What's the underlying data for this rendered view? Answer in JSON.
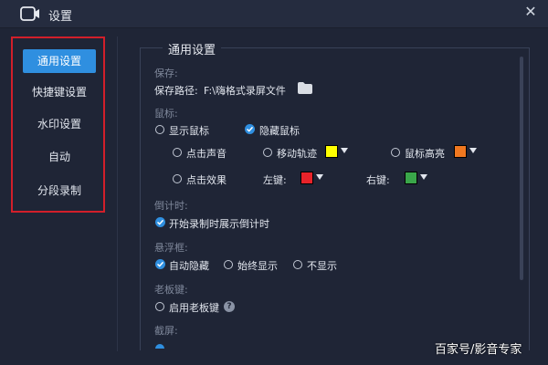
{
  "window": {
    "title": "设置",
    "close_icon": "close-icon",
    "app_icon": "video-camera-icon"
  },
  "sidebar": {
    "items": [
      {
        "label": "通用设置",
        "active": true
      },
      {
        "label": "快捷键设置",
        "active": false
      },
      {
        "label": "水印设置",
        "active": false
      },
      {
        "label": "自动",
        "active": false
      },
      {
        "label": "分段录制",
        "active": false
      }
    ]
  },
  "general": {
    "panel_title": "通用设置",
    "save": {
      "section": "保存:",
      "path_label": "保存路径:",
      "path_value": "F:\\嗨格式录屏文件",
      "folder_icon": "folder-icon"
    },
    "mouse": {
      "section": "鼠标:",
      "show_cursor": "显示鼠标",
      "hide_cursor": "隐藏鼠标",
      "click_sound": "点击声音",
      "move_track": "移动轨迹",
      "cursor_highlight": "鼠标高亮",
      "click_effect": "点击效果",
      "left_key": "左键:",
      "right_key": "右键:",
      "colors": {
        "move_track": "#ffff00",
        "cursor_highlight": "#f07820",
        "left_key": "#e8232a",
        "right_key": "#3aa64a"
      }
    },
    "countdown": {
      "section": "倒计时:",
      "option": "开始录制时展示倒计时"
    },
    "float": {
      "section": "悬浮框:",
      "auto_hide": "自动隐藏",
      "always_show": "始终显示",
      "no_show": "不显示"
    },
    "boss_key": {
      "section": "老板键:",
      "option": "启用老板键",
      "help_icon": "?"
    },
    "screenshot": {
      "section": "截屏:"
    }
  },
  "watermark_text": "百家号/影音专家",
  "colors": {
    "accent": "#2f8fe0",
    "highlight_frame": "#d21f2a"
  }
}
